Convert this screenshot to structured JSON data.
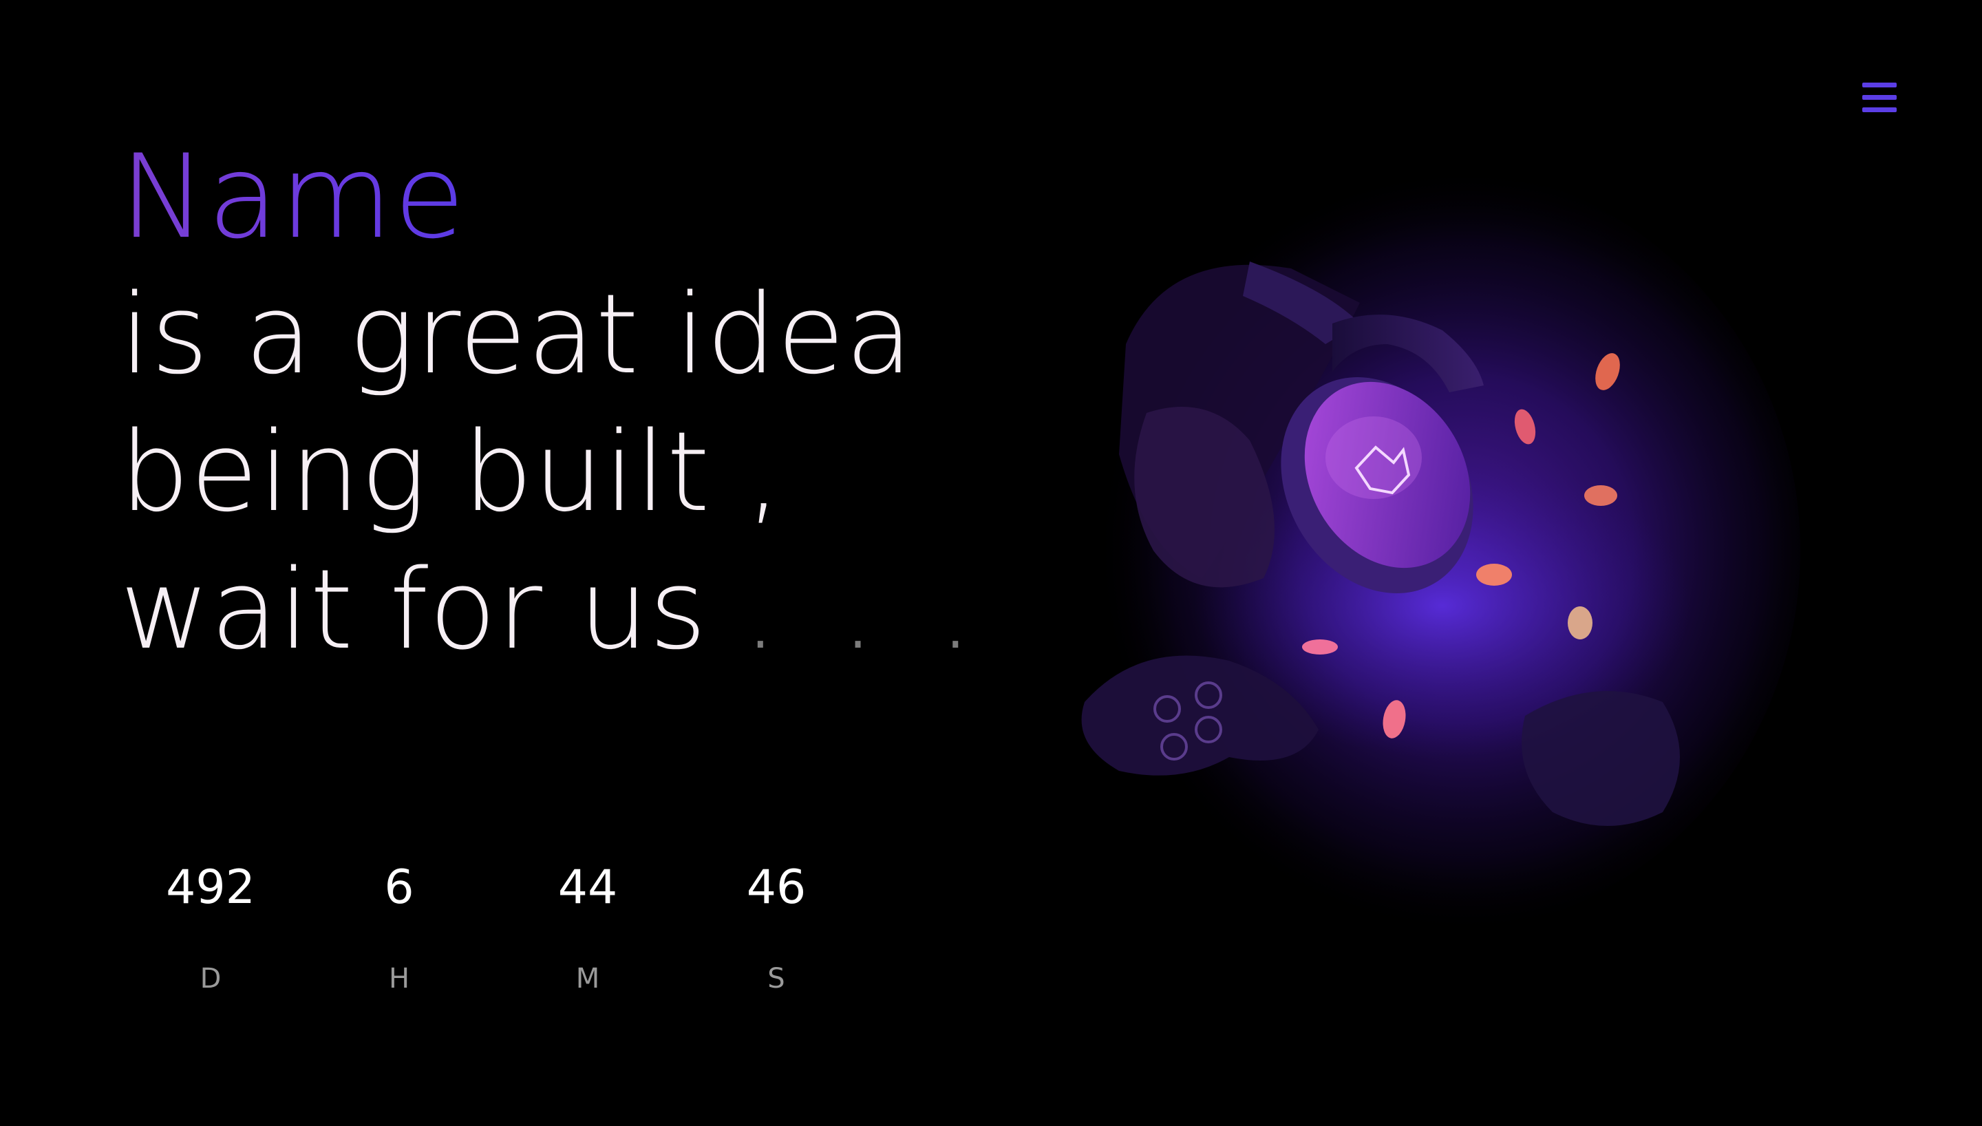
{
  "header": {
    "menu_icon": "hamburger-menu-icon",
    "accent_color": "#5b3ee6"
  },
  "headline": {
    "name": "Name",
    "line1": "is a great idea",
    "line2": "being built ,",
    "line3": "wait for us",
    "dots": ". . .",
    "name_gradient": [
      "#7b3fd1",
      "#5b3be6"
    ]
  },
  "countdown": {
    "days": "492",
    "days_label": "D",
    "hours": "6",
    "hours_label": "H",
    "minutes": "44",
    "minutes_label": "M",
    "seconds": "46",
    "seconds_label": "S"
  },
  "hero_image": {
    "subject": "gaming-headset-and-controller-photo",
    "palette": [
      "#2a0a55",
      "#6b1fa8",
      "#3a1dbf"
    ]
  }
}
